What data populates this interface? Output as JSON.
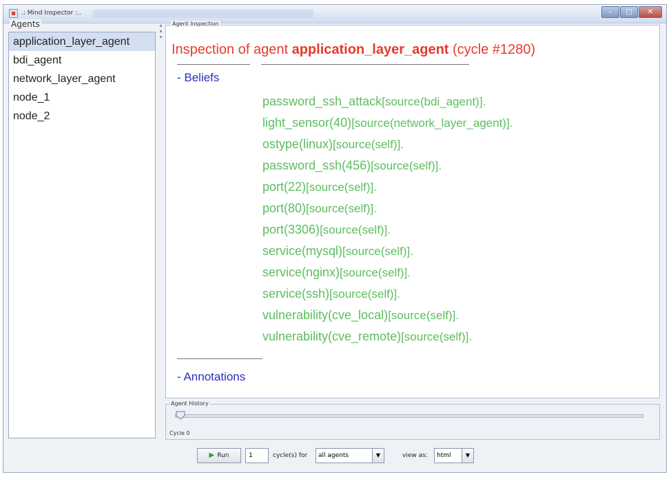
{
  "window": {
    "title": ".: Mind Inspector :..",
    "minimize_label": "–",
    "maximize_label": "□",
    "close_label": "✕"
  },
  "agents": {
    "title": "Agents",
    "items": [
      "application_layer_agent",
      "bdi_agent",
      "network_layer_agent",
      "node_1",
      "node_2"
    ],
    "selected": "application_layer_agent"
  },
  "inspection": {
    "panel_title": "Agent Inspection",
    "heading_prefix": "Inspection of agent ",
    "agent_name": "application_layer_agent",
    "heading_suffix": " (cycle #1280)",
    "beliefs_title": "- Beliefs",
    "beliefs": [
      {
        "belief": "password_ssh_attack",
        "source": "[source(bdi_agent)]."
      },
      {
        "belief": "light_sensor(40)",
        "source": "[source(network_layer_agent)]."
      },
      {
        "belief": "ostype(linux)",
        "source": "[source(self)]."
      },
      {
        "belief": "password_ssh(456)",
        "source": "[source(self)]."
      },
      {
        "belief": "port(22)",
        "source": "[source(self)]."
      },
      {
        "belief": "port(80)",
        "source": "[source(self)]."
      },
      {
        "belief": "port(3306)",
        "source": "[source(self)]."
      },
      {
        "belief": "service(mysql)",
        "source": "[source(self)]."
      },
      {
        "belief": "service(nginx)",
        "source": "[source(self)]."
      },
      {
        "belief": "service(ssh)",
        "source": "[source(self)]."
      },
      {
        "belief": "vulnerability(cve_local)",
        "source": "[source(self)]."
      },
      {
        "belief": "vulnerability(cve_remote)",
        "source": "[source(self)]."
      }
    ],
    "annotations_title": "- Annotations"
  },
  "history": {
    "title": "Agent History",
    "cycle_label": "Cycle 0",
    "slider_position": 0
  },
  "controls": {
    "run_label": "Run",
    "cycles_value": "1",
    "cycles_for_label": "cycle(s) for",
    "agent_select_value": "all agents",
    "view_as_label": "view as:",
    "view_select_value": "html"
  },
  "colors": {
    "heading": "#e53b2e",
    "beliefs": "#5cbe5f",
    "section_title": "#2a2fb8",
    "selected_row": "#d4def1"
  }
}
